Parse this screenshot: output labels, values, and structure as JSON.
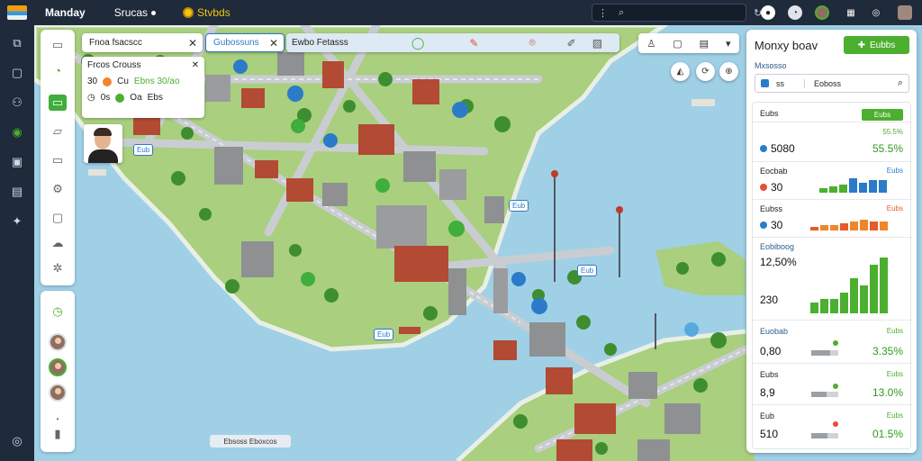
{
  "topbar": {
    "brand": "Manday",
    "nav_search": "Srucas",
    "nav_status": "Stvbds",
    "search_placeholder": ""
  },
  "filters": {
    "chip1": "Fnoa fsacscc",
    "chip2": "Gubossuns",
    "chip3": "Ewbo Fetasss"
  },
  "info_card": {
    "title": "Frcos Crouss",
    "row1": [
      "30",
      "Cu",
      "Ebns 30/ao"
    ],
    "row2": [
      "0s",
      "Oa",
      "Ebs"
    ]
  },
  "map_badges": [
    "Eub",
    "Eub",
    "Eub",
    "Eub"
  ],
  "scale_label": "Ebsoss Eboxcos",
  "right_panel": {
    "title": "Monxy boav",
    "action_button": "Eubbs",
    "subtitle": "Mxsosso",
    "search_text": "Eoboss",
    "search_tag": "ss",
    "stats": {
      "header_label": "Eubs",
      "header_button": "Eubs",
      "row1": {
        "label": "",
        "pct": "55.5%",
        "value": "5080",
        "big": "55.5%"
      },
      "row2": {
        "label": "Eocbab",
        "pct": "Eubs",
        "value": "30"
      },
      "row3": {
        "label": "Eubss",
        "pct": "Eubs",
        "value": "30"
      },
      "row4": {
        "label": "Eobiboog",
        "value": "12,50%",
        "value2": "230"
      },
      "row5": {
        "label": "Euobab",
        "pct": "Eubs",
        "value": "0,80",
        "big": "3.35%"
      },
      "row6": {
        "label": "Eubs",
        "pct": "Eubs",
        "value": "8,9",
        "big": "13.0%"
      },
      "row7": {
        "label": "Eub",
        "pct": "Eubs",
        "value": "510",
        "big": "01.5%"
      }
    },
    "bars_row2": [
      2,
      3,
      4,
      7,
      5,
      6,
      6
    ],
    "bars_row3": [
      2,
      3,
      3,
      4,
      5,
      6,
      5,
      5
    ],
    "bars_row4": [
      3,
      4,
      4,
      6,
      10,
      8,
      14,
      16
    ]
  },
  "colors": {
    "accent_green": "#4caf2f",
    "accent_blue": "#2b7bc9",
    "rail_dark": "#1f2a3a",
    "water": "#9fd0e6",
    "bar_blue": "#2b7bc9",
    "bar_orange": "#f0862a",
    "bar_red": "#e85a2b",
    "bar_green": "#4caf2f"
  }
}
